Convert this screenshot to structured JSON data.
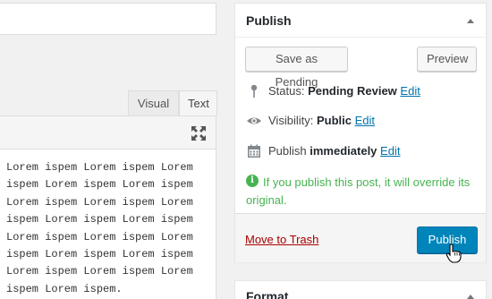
{
  "editor": {
    "tabs": [
      {
        "label": "Visual",
        "active": false
      },
      {
        "label": "Text",
        "active": true
      }
    ],
    "fullscreen_icon": "fullscreen-icon",
    "content": "Lorem ispem Lorem ispem Lorem\nispem Lorem ispem Lorem ispem\nLorem ispem Lorem ispem Lorem\nispem Lorem ispem Lorem ispem\nLorem ispem Lorem ispem Lorem\nispem Lorem ispem Lorem ispem\nLorem ispem Lorem ispem Lorem\nispem Lorem ispem."
  },
  "publish_box": {
    "title": "Publish",
    "save_pending_label": "Save as Pending",
    "preview_label": "Preview",
    "status": {
      "label": "Status:",
      "value": "Pending Review",
      "edit": "Edit",
      "icon": "pin-icon"
    },
    "visibility": {
      "label": "Visibility:",
      "value": "Public",
      "edit": "Edit",
      "icon": "eye-icon"
    },
    "schedule": {
      "label": "Publish",
      "value": "immediately",
      "edit": "Edit",
      "icon": "calendar-icon"
    },
    "notice": "If you publish this post, it will override its original.",
    "notice_icon": "info-icon",
    "trash_label": "Move to Trash",
    "publish_label": "Publish"
  },
  "format_box": {
    "title": "Format"
  },
  "colors": {
    "accent": "#0085ba",
    "link": "#0073aa",
    "trash": "#aa0000",
    "notice": "#46b450"
  }
}
